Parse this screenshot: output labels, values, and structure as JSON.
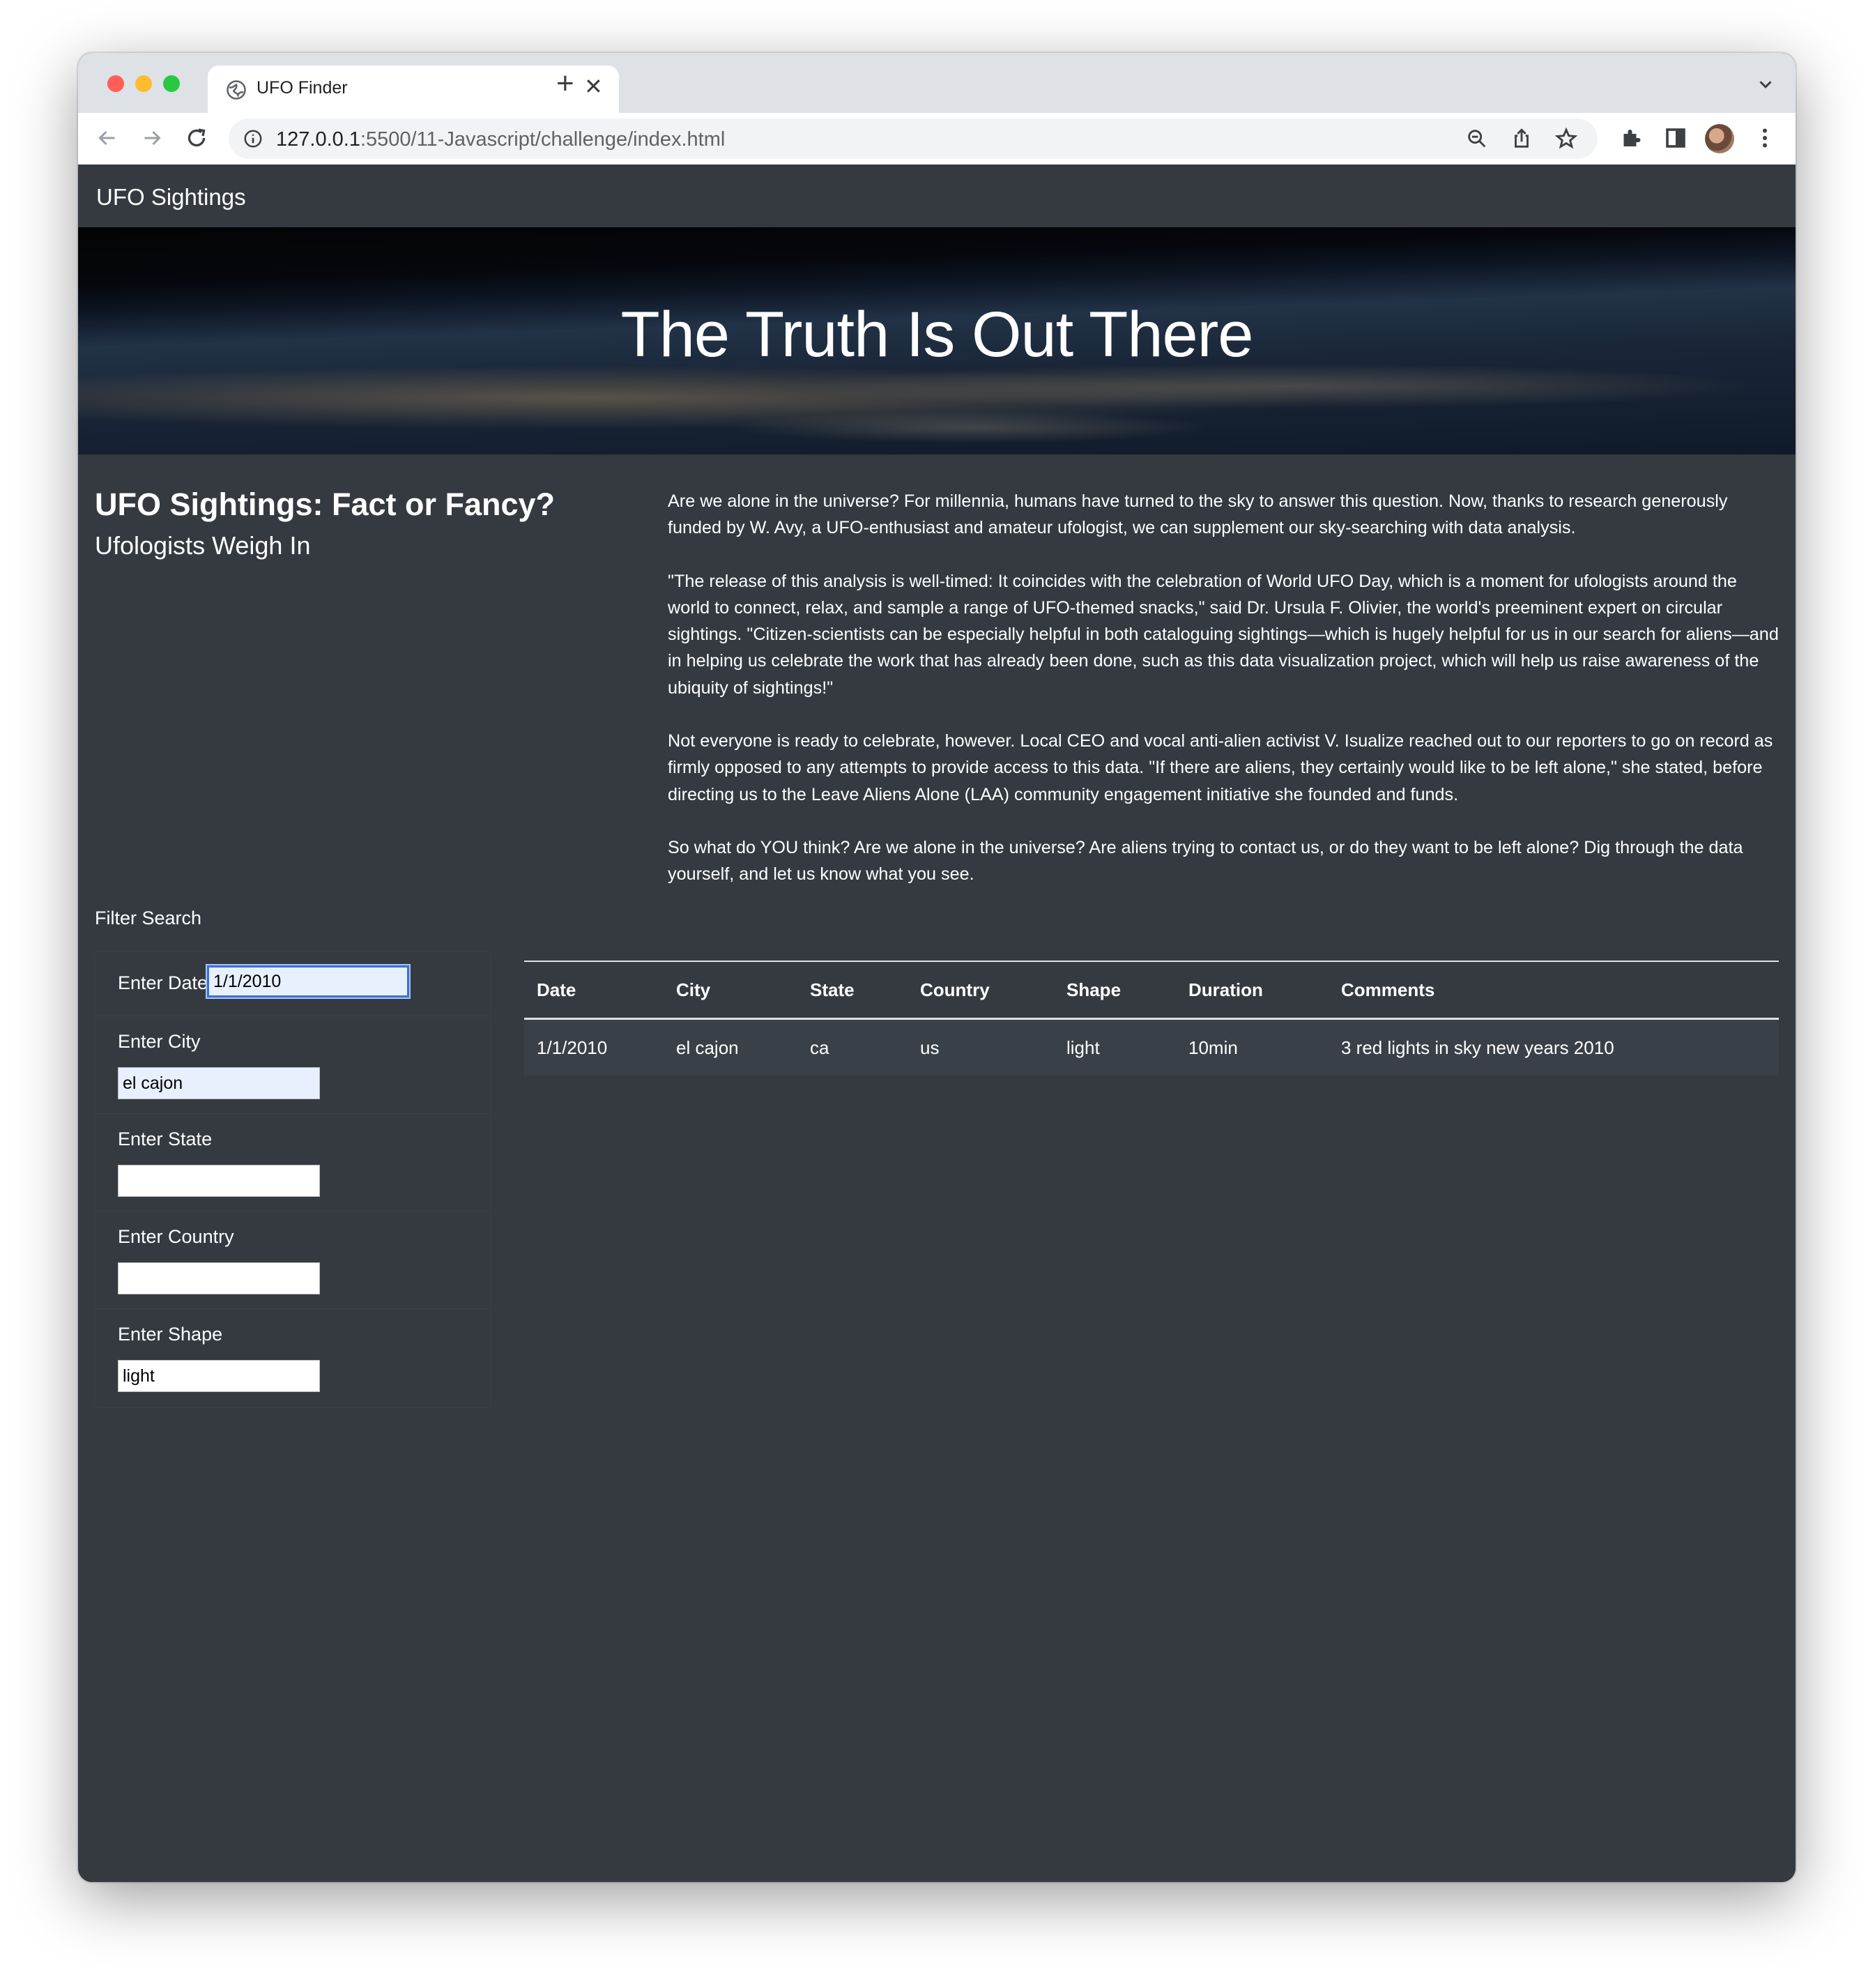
{
  "browser": {
    "tab_title": "UFO Finder",
    "url_host": "127.0.0.1",
    "url_path": ":5500/11-Javascript/challenge/index.html"
  },
  "navbar": {
    "brand": "UFO Sightings"
  },
  "hero": {
    "title": "The Truth Is Out There"
  },
  "intro": {
    "title": "UFO Sightings: Fact or Fancy?",
    "subtitle": "Ufologists Weigh In"
  },
  "article": {
    "paragraphs": [
      "Are we alone in the universe? For millennia, humans have turned to the sky to answer this question. Now, thanks to research generously funded by W. Avy, a UFO-enthusiast and amateur ufologist, we can supplement our sky-searching with data analysis.",
      "\"The release of this analysis is well-timed: It coincides with the celebration of World UFO Day, which is a moment for ufologists around the world to connect, relax, and sample a range of UFO-themed snacks,\" said Dr. Ursula F. Olivier, the world's preeminent expert on circular sightings. \"Citizen-scientists can be especially helpful in both cataloguing sightings—which is hugely helpful for us in our search for aliens—and in helping us celebrate the work that has already been done, such as this data visualization project, which will help us raise awareness of the ubiquity of sightings!\"",
      "Not everyone is ready to celebrate, however. Local CEO and vocal anti-alien activist V. Isualize reached out to our reporters to go on record as firmly opposed to any attempts to provide access to this data. \"If there are aliens, they certainly would like to be left alone,\" she stated, before directing us to the Leave Aliens Alone (LAA) community engagement initiative she founded and funds.",
      "So what do YOU think? Are we alone in the universe? Are aliens trying to contact us, or do they want to be left alone? Dig through the data yourself, and let us know what you see."
    ]
  },
  "filters": {
    "title": "Filter Search",
    "items": [
      {
        "label": "Enter Date",
        "value": "1/1/2010"
      },
      {
        "label": "Enter City",
        "value": "el cajon"
      },
      {
        "label": "Enter State",
        "value": ""
      },
      {
        "label": "Enter Country",
        "value": ""
      },
      {
        "label": "Enter Shape",
        "value": "light"
      }
    ]
  },
  "table": {
    "headers": [
      "Date",
      "City",
      "State",
      "Country",
      "Shape",
      "Duration",
      "Comments"
    ],
    "rows": [
      [
        "1/1/2010",
        "el cajon",
        "ca",
        "us",
        "light",
        "10min",
        "3 red lights in sky new years 2010"
      ]
    ]
  }
}
